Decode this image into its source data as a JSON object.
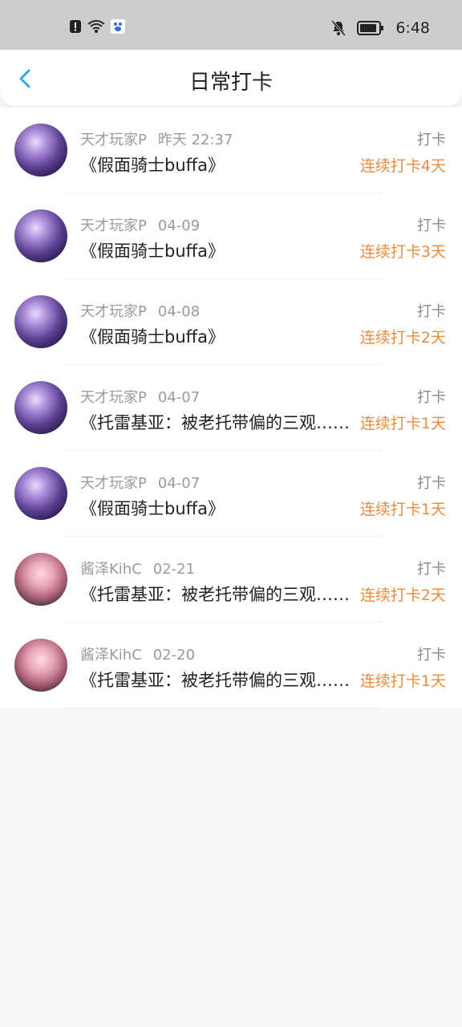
{
  "status_bar": {
    "time": "6:48",
    "icons": [
      "alert-icon",
      "wifi-icon",
      "baidu-app-icon",
      "bell-off-icon",
      "battery-icon"
    ]
  },
  "header": {
    "title": "日常打卡",
    "back_icon": "chevron-left-icon"
  },
  "colors": {
    "accent_blue": "#2ea8e6",
    "streak_orange": "#f08a3a",
    "muted_text": "#9a9a9a"
  },
  "checkins": [
    {
      "user": "天才玩家P",
      "time": "昨天 22:37",
      "content": "《假面骑士buffa》",
      "tag": "打卡",
      "streak": "连续打卡4天",
      "avatar": "avatar-a"
    },
    {
      "user": "天才玩家P",
      "time": "04-09",
      "content": "《假面骑士buffa》",
      "tag": "打卡",
      "streak": "连续打卡3天",
      "avatar": "avatar-a"
    },
    {
      "user": "天才玩家P",
      "time": "04-08",
      "content": "《假面骑士buffa》",
      "tag": "打卡",
      "streak": "连续打卡2天",
      "avatar": "avatar-a"
    },
    {
      "user": "天才玩家P",
      "time": "04-07",
      "content": "《托雷基亚：被老托带偏的三观……",
      "tag": "打卡",
      "streak": "连续打卡1天",
      "avatar": "avatar-a"
    },
    {
      "user": "天才玩家P",
      "time": "04-07",
      "content": "《假面骑士buffa》",
      "tag": "打卡",
      "streak": "连续打卡1天",
      "avatar": "avatar-a"
    },
    {
      "user": "酱泽KihC",
      "time": "02-21",
      "content": "《托雷基亚：被老托带偏的三观……",
      "tag": "打卡",
      "streak": "连续打卡2天",
      "avatar": "avatar-b"
    },
    {
      "user": "酱泽KihC",
      "time": "02-20",
      "content": "《托雷基亚：被老托带偏的三观……",
      "tag": "打卡",
      "streak": "连续打卡1天",
      "avatar": "avatar-b"
    }
  ]
}
